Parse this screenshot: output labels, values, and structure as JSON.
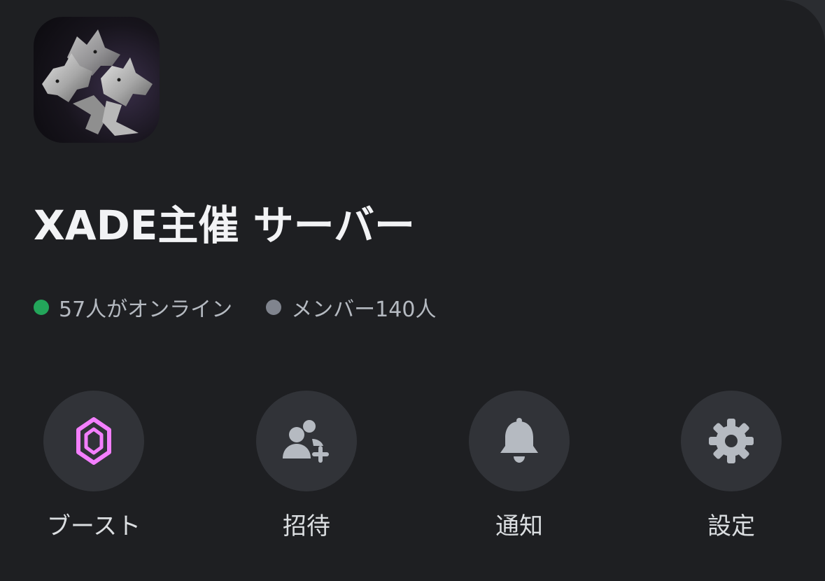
{
  "server": {
    "name": "XADE主催 サーバー",
    "icon": "wolf-pack-logo"
  },
  "stats": {
    "online_text": "57人がオンライン",
    "online_color": "#23a55a",
    "members_text": "メンバー140人",
    "members_color": "#80848e"
  },
  "actions": [
    {
      "label": "ブースト",
      "icon": "boost-gem-icon",
      "color": "#f47fff"
    },
    {
      "label": "招待",
      "icon": "invite-user-icon",
      "color": "#b5bac1"
    },
    {
      "label": "通知",
      "icon": "bell-icon",
      "color": "#b5bac1"
    },
    {
      "label": "設定",
      "icon": "gear-icon",
      "color": "#b5bac1"
    }
  ]
}
